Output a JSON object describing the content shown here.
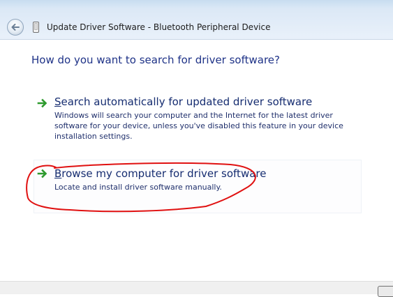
{
  "window": {
    "title": "Update Driver Software - Bluetooth Peripheral Device"
  },
  "page": {
    "heading": "How do you want to search for driver software?"
  },
  "options": [
    {
      "title_initial": "S",
      "title_rest": "earch automatically for updated driver software",
      "description": "Windows will search your computer and the Internet for the latest driver software for your device, unless you've disabled this feature in your device installation settings."
    },
    {
      "title_initial": "B",
      "title_rest": "rowse my computer for driver software",
      "description": "Locate and install driver software manually."
    }
  ],
  "icons": {
    "back": "back-arrow-icon",
    "device": "device-icon",
    "option_arrow": "green-arrow-icon"
  },
  "colors": {
    "heading": "#1e3287",
    "link_text": "#152c70",
    "arrow_green": "#2e9a2e",
    "annotation_red": "#e01010"
  }
}
